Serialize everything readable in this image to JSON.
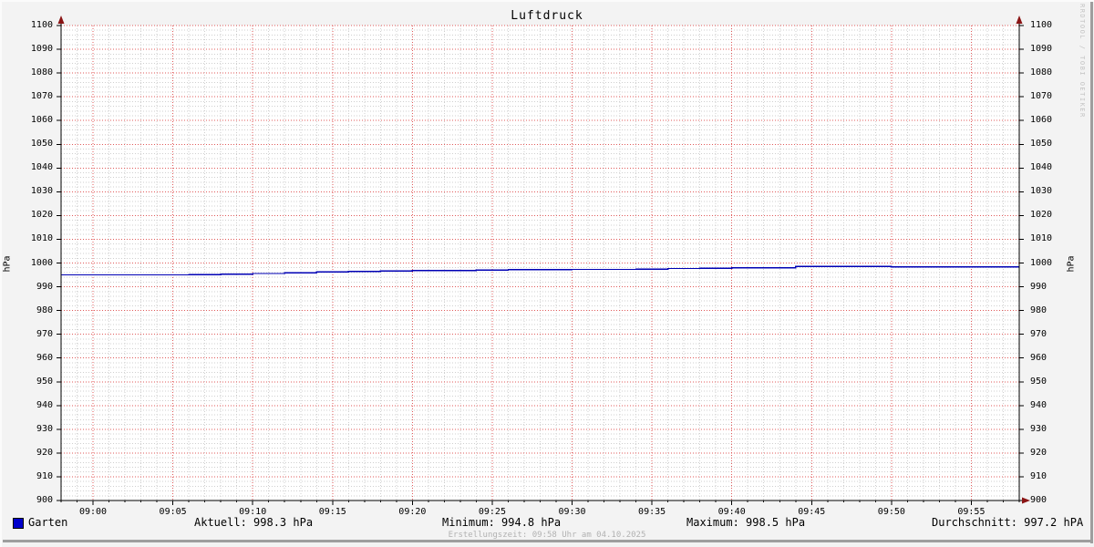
{
  "title": "Luftdruck",
  "watermark": "RRDTOOL / TOBI OETIKER",
  "footer": {
    "creation_text": "Erstellungszeit: 09:58 Uhr am 04.10.2025"
  },
  "legend": {
    "series_label": "Garten",
    "current": "Aktuell: 998.3 hPa",
    "minimum": "Minimum: 994.8 hPa",
    "maximum": "Maximum: 998.5 hPa",
    "average": "Durchschnitt: 997.2 hPA"
  },
  "colors": {
    "background": "#f3f3f3",
    "canvas": "#ffffff",
    "line": "#0000b4",
    "legend_swatch": "#0000cc",
    "axis": "#000000",
    "arrow": "#8a1414",
    "major_grid": "#e05a5a",
    "minor_grid": "#cfcfcf",
    "footer_text": "#b2b2b2",
    "watermark_text": "#c4c4c4",
    "shadow_border": "#9e9e9e"
  },
  "chart_data": {
    "type": "line",
    "title": "Luftdruck",
    "ylabel": "hPa",
    "ylabel_right": "hPa",
    "ylim": [
      900,
      1100
    ],
    "y_tick_step": 10,
    "y_minor_step": 2,
    "grid": true,
    "x_start_label": "08:58",
    "x_end_label": "09:58",
    "x_span_minutes": 60,
    "x_tick_labels": [
      "09:00",
      "09:05",
      "09:10",
      "09:15",
      "09:20",
      "09:25",
      "09:30",
      "09:35",
      "09:40",
      "09:45",
      "09:50",
      "09:55"
    ],
    "x_tick_interval_minutes": 5,
    "x_minor_interval_minutes": 1,
    "series": [
      {
        "name": "Garten",
        "color": "#0000b4",
        "t_min": [
          0,
          2,
          4,
          6,
          8,
          10,
          12,
          14,
          16,
          18,
          20,
          22,
          24,
          26,
          28,
          30,
          32,
          34,
          36,
          38,
          40,
          42,
          44,
          46,
          48,
          50,
          52,
          54,
          56,
          58,
          60
        ],
        "values": [
          995.0,
          995.0,
          995.0,
          995.0,
          995.1,
          995.3,
          995.6,
          995.9,
          996.2,
          996.5,
          996.6,
          996.8,
          996.9,
          997.1,
          997.2,
          997.2,
          997.3,
          997.3,
          997.4,
          997.7,
          997.8,
          998.0,
          998.0,
          998.5,
          998.5,
          998.5,
          998.3,
          998.3,
          998.3,
          998.3,
          998.3
        ]
      }
    ],
    "stats": {
      "current": 998.3,
      "min": 994.8,
      "max": 998.5,
      "avg": 997.2
    }
  }
}
